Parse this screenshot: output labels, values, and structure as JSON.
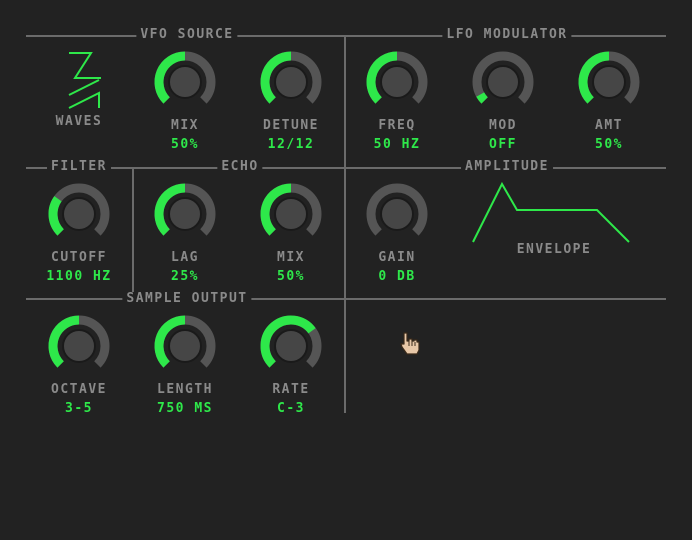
{
  "sections": {
    "vfo_source": "VFO SOURCE",
    "lfo_modulator": "LFO MODULATOR",
    "filter": "FILTER",
    "echo": "ECHO",
    "amplitude": "AMPLITUDE",
    "sample_output": "SAMPLE OUTPUT"
  },
  "controls": {
    "waves": {
      "label": "WAVES",
      "value": ""
    },
    "vfo_mix": {
      "label": "MIX",
      "value": "50%",
      "level": 0.5
    },
    "detune": {
      "label": "DETUNE",
      "value": "12/12",
      "level": 0.5
    },
    "freq": {
      "label": "FREQ",
      "value": "50 HZ",
      "level": 0.5
    },
    "mod": {
      "label": "MOD",
      "value": "OFF",
      "level": 0.06
    },
    "amt": {
      "label": "AMT",
      "value": "50%",
      "level": 0.5
    },
    "cutoff": {
      "label": "CUTOFF",
      "value": "1100 HZ",
      "level": 0.3
    },
    "lag": {
      "label": "LAG",
      "value": "25%",
      "level": 0.5
    },
    "echo_mix": {
      "label": "MIX",
      "value": "50%",
      "level": 0.5
    },
    "gain": {
      "label": "GAIN",
      "value": "0 DB",
      "level": 0.0
    },
    "envelope": {
      "label": "ENVELOPE"
    },
    "octave": {
      "label": "OCTAVE",
      "value": "3-5",
      "level": 0.5
    },
    "length": {
      "label": "LENGTH",
      "value": "750 MS",
      "level": 0.5
    },
    "rate": {
      "label": "RATE",
      "value": "C-3",
      "level": 0.7
    }
  },
  "colors": {
    "background": "#222222",
    "accent": "#2ee84a",
    "label": "#8a8a8a",
    "knob_track": "#555555",
    "knob_face": "#464646"
  },
  "icons": {
    "waves": "sawtooth-wave-icon",
    "envelope": "adsr-envelope-icon",
    "cursor": "hand-pointer-icon"
  }
}
